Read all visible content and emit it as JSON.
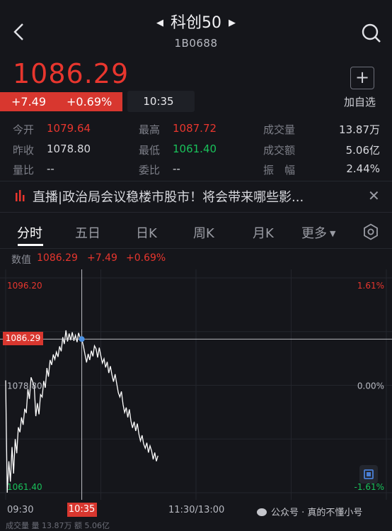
{
  "header": {
    "title": "科创50",
    "code": "1B0688",
    "prev_icon": "triangle-left-icon",
    "next_icon": "triangle-right-icon",
    "back_icon": "chevron-left-icon",
    "search_icon": "search-icon"
  },
  "quote": {
    "price": "1086.29",
    "change": "+7.49",
    "change_pct": "+0.69%",
    "time": "10:35",
    "add_label": "加自选"
  },
  "stats": {
    "open_label": "今开",
    "open": "1079.64",
    "high_label": "最高",
    "high": "1087.72",
    "volume_label": "成交量",
    "volume": "13.87万",
    "prev_close_label": "昨收",
    "prev_close": "1078.80",
    "low_label": "最低",
    "low": "1061.40",
    "amount_label": "成交额",
    "amount": "5.06亿",
    "vol_ratio_label": "量比",
    "vol_ratio": "--",
    "bid_ratio_label": "委比",
    "bid_ratio": "--",
    "amplitude_label": "振　幅",
    "amplitude": "2.44%"
  },
  "news": {
    "text": "直播|政治局会议稳楼市股市！将会带来哪些影...",
    "close_icon": "close-icon"
  },
  "tabs": [
    "分时",
    "五日",
    "日K",
    "周K",
    "月K",
    "更多"
  ],
  "chart_info": {
    "label": "数值",
    "value": "1086.29",
    "change": "+7.49",
    "pct": "+0.69%"
  },
  "chart_data": {
    "type": "line",
    "y_labels_left": [
      "1096.20",
      "1078.80",
      "1061.40"
    ],
    "y_labels_right": [
      "1.61%",
      "0.00%",
      "-1.61%"
    ],
    "x_labels": [
      "09:30",
      "10:35",
      "11:30/13:00"
    ],
    "ylim": [
      1061.4,
      1096.2
    ],
    "prev_close": 1078.8,
    "crosshair_value": "1086.29",
    "crosshair_time": "10:35",
    "minutes": [
      0,
      1,
      2,
      3,
      4,
      5,
      6,
      7,
      8,
      9,
      10,
      11,
      12,
      13,
      14,
      15,
      16,
      17,
      18,
      19,
      20,
      21,
      22,
      23,
      24,
      25,
      26,
      27,
      28,
      29,
      30,
      31,
      32,
      33,
      34,
      35,
      36,
      37,
      38,
      39,
      40,
      41,
      42,
      43,
      44,
      45,
      46,
      47,
      48,
      49,
      50,
      51,
      52,
      53,
      54,
      55,
      56,
      57,
      58,
      59,
      60,
      61,
      62,
      63,
      64,
      65,
      66,
      67,
      68,
      69,
      70,
      71,
      72,
      73,
      74,
      75,
      76,
      77,
      78,
      79,
      80,
      81,
      82,
      83,
      84,
      85,
      86,
      87,
      88,
      89,
      90,
      91,
      92,
      93,
      94,
      95,
      96,
      97,
      98,
      99,
      100,
      101,
      102,
      103,
      104,
      105,
      106,
      107,
      108,
      109,
      110,
      111,
      112,
      113,
      114,
      115,
      116,
      117,
      118,
      119,
      120,
      121,
      122,
      123,
      124,
      125,
      126,
      127,
      128,
      129,
      130
    ],
    "values": [
      1079.6,
      1061.4,
      1066.5,
      1063.2,
      1068.8,
      1064.5,
      1070.1,
      1067.8,
      1072.0,
      1071.2,
      1073.6,
      1072.4,
      1075.0,
      1074.3,
      1078.2,
      1076.6,
      1080.1,
      1079.4,
      1078.6,
      1073.8,
      1075.9,
      1074.1,
      1077.3,
      1076.9,
      1079.5,
      1078.4,
      1081.6,
      1080.2,
      1082.9,
      1082.1,
      1083.8,
      1083.0,
      1084.2,
      1083.4,
      1085.1,
      1084.3,
      1086.6,
      1085.5,
      1087.7,
      1085.9,
      1087.2,
      1086.1,
      1087.4,
      1086.0,
      1086.9,
      1085.8,
      1087.3,
      1086.4,
      1086.29,
      1085.2,
      1083.8,
      1082.5,
      1083.9,
      1082.9,
      1084.4,
      1083.5,
      1085.2,
      1084.7,
      1083.3,
      1084.9,
      1083.6,
      1082.4,
      1083.1,
      1081.7,
      1082.6,
      1080.8,
      1081.9,
      1080.5,
      1079.4,
      1080.6,
      1079.1,
      1077.6,
      1076.9,
      1077.8,
      1075.7,
      1074.4,
      1075.2,
      1073.6,
      1074.9,
      1073.0,
      1071.9,
      1072.9,
      1071.4,
      1072.6,
      1070.9,
      1069.8,
      1070.7,
      1069.3,
      1068.6,
      1069.5,
      1067.9,
      1069.0,
      1068.2,
      1066.8,
      1067.9,
      1066.5,
      1067.4
    ]
  },
  "volume_footer": "成交量  量 13.87万  额 5.06亿",
  "watermark": "公众号 · 真的不懂小号",
  "colors": {
    "up": "#e8362e",
    "down": "#19c15a",
    "bg": "#15161b",
    "line": "#ffffff",
    "crosshair": "#cfd0d6",
    "dot": "#4a90e2"
  }
}
